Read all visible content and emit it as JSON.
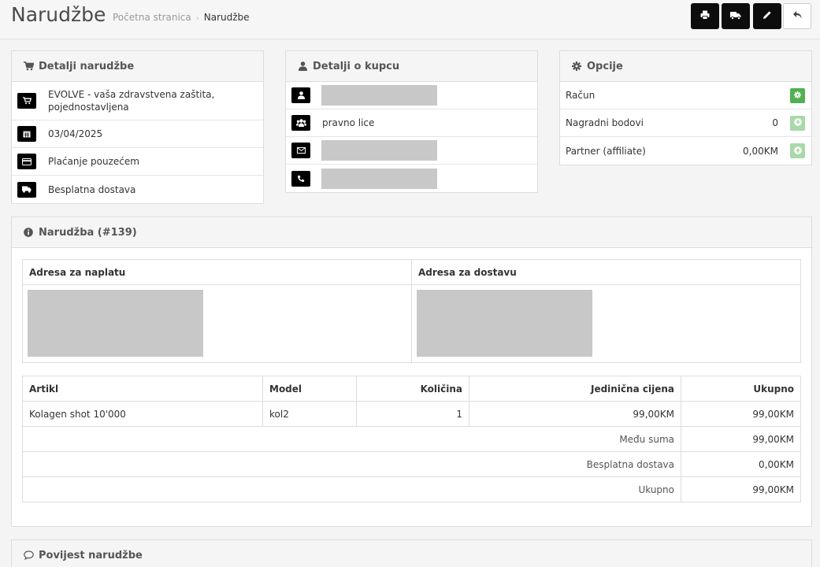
{
  "header": {
    "title": "Narudžbe",
    "breadcrumb": {
      "home": "Početna stranica",
      "separator": "›",
      "current": "Narudžbe"
    },
    "buttons": [
      "print-icon",
      "truck-icon",
      "pencil-icon",
      "reply-icon"
    ]
  },
  "order_details": {
    "heading": "Detalji narudžbe",
    "store": "EVOLVE - vaša zdravstvena zaštita, pojednostavljena",
    "date": "03/04/2025",
    "payment": "Plaćanje pouzećem",
    "shipping": "Besplatna dostava"
  },
  "customer": {
    "heading": "Detalji o kupcu",
    "group": "pravno lice"
  },
  "options": {
    "heading": "Opcije",
    "invoice_label": "Račun",
    "reward_label": "Nagradni bodovi",
    "reward_value": "0",
    "affiliate_label": "Partner (affiliate)",
    "affiliate_value": "0,00KM"
  },
  "order": {
    "heading": "Narudžba (#139)",
    "billing_label": "Adresa za naplatu",
    "shipping_label": "Adresa za dostavu",
    "columns": {
      "product": "Artikl",
      "model": "Model",
      "quantity": "Količina",
      "unit_price": "Jedinična cijena",
      "total": "Ukupno"
    },
    "items": [
      {
        "product": "Kolagen shot 10'000",
        "model": "kol2",
        "quantity": "1",
        "unit_price": "99,00KM",
        "total": "99,00KM"
      }
    ],
    "totals": [
      {
        "label": "Među suma",
        "value": "99,00KM"
      },
      {
        "label": "Besplatna dostava",
        "value": "0,00KM"
      },
      {
        "label": "Ukupno",
        "value": "99,00KM"
      }
    ]
  },
  "history": {
    "heading": "Povijest narudžbe"
  }
}
